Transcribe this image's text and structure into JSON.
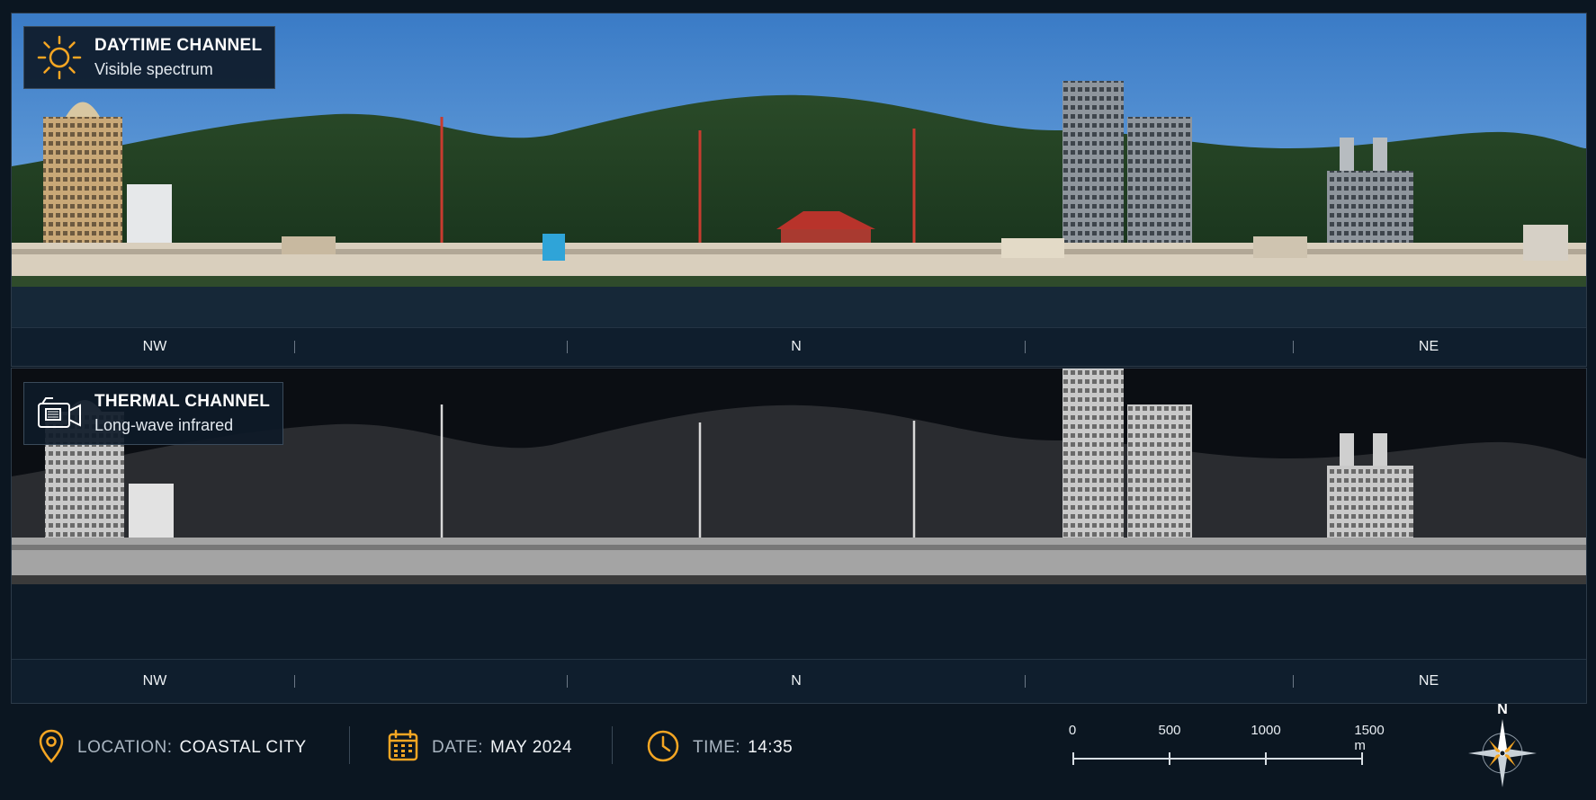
{
  "day_panel": {
    "title": "DAYTIME CHANNEL",
    "subtitle": "Visible spectrum",
    "icon": "sun-icon",
    "accent": "#f5a623",
    "bearings": [
      "NW",
      "N",
      "NE"
    ]
  },
  "thermal_panel": {
    "title": "THERMAL CHANNEL",
    "subtitle": "Long-wave infrared",
    "icon": "thermal-camera-icon",
    "bearings": [
      "NW",
      "N",
      "NE"
    ]
  },
  "footer": {
    "location": {
      "label": "LOCATION:",
      "value": "COASTAL CITY",
      "icon": "location-pin-icon"
    },
    "date": {
      "label": "DATE:",
      "value": "MAY 2024",
      "icon": "calendar-icon"
    },
    "time": {
      "label": "TIME:",
      "value": "14:35",
      "icon": "clock-icon"
    },
    "scale_bar": {
      "ticks": [
        "0",
        "500",
        "1000",
        "1500 m"
      ]
    },
    "compass": {
      "label": "N",
      "icon": "compass-rose-icon"
    }
  },
  "colors": {
    "accent_orange": "#f5a623",
    "background": "#0b1621",
    "sky_top": "#3f7fc8",
    "hill_green": "#1e3a22"
  }
}
